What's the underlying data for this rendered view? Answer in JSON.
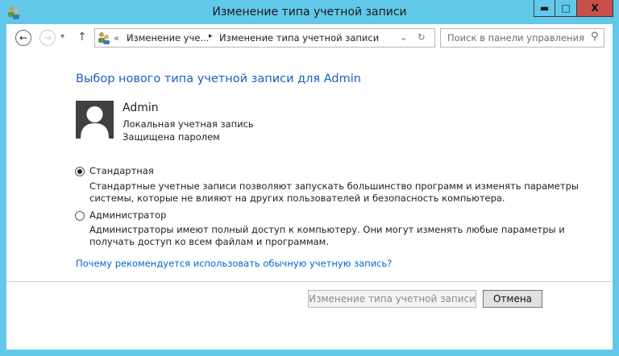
{
  "window": {
    "title": "Изменение типа учетной записи",
    "minimize": "▬",
    "maximize": "□",
    "close": "X"
  },
  "nav": {
    "back": "←",
    "forward": "→",
    "recent": "▾",
    "up": "↑"
  },
  "address": {
    "overflow": "«",
    "crumbs": [
      "Изменение уче...",
      "Изменение типа учетной записи"
    ],
    "separator": "▸",
    "dropdown": "⌄",
    "refresh": "↻"
  },
  "search": {
    "placeholder": "Поиск в панели управления",
    "icon": "⚲"
  },
  "heading": "Выбор нового типа учетной записи для Admin",
  "user": {
    "name": "Admin",
    "type": "Локальная учетная запись",
    "status": "Защищена паролем"
  },
  "options": [
    {
      "label": "Стандартная",
      "selected": true,
      "desc1": "Стандартные учетные записи позволяют запускать большинство программ и изменять параметры",
      "desc2": "системы, которые не влияют на других пользователей и безопасность компьютера."
    },
    {
      "label": "Администратор",
      "selected": false,
      "desc1": "Администраторы имеют полный доступ к компьютеру. Они могут изменять любые параметры и",
      "desc2": "получать доступ ко всем файлам и программам."
    }
  ],
  "help_link": "Почему рекомендуется использовать обычную учетную запись?",
  "buttons": {
    "change": "Изменение типа учетной записи",
    "cancel": "Отмена"
  }
}
